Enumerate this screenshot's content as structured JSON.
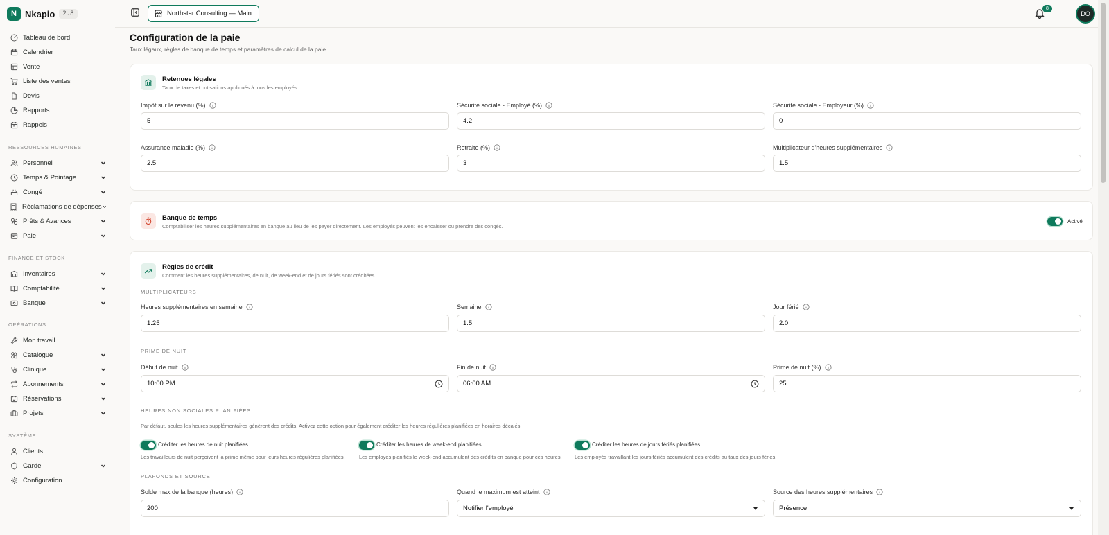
{
  "app": {
    "name": "Nkapio",
    "version": "2.8"
  },
  "topbar": {
    "org_name": "Northstar Consulting — Main",
    "notifications": "8",
    "avatar_initials": "DO"
  },
  "sidebar": {
    "main": [
      {
        "label": "Tableau de bord",
        "icon": "dashboard-icon"
      },
      {
        "label": "Calendrier",
        "icon": "calendar-icon"
      },
      {
        "label": "Vente",
        "icon": "pos-icon"
      },
      {
        "label": "Liste des ventes",
        "icon": "cart-icon"
      },
      {
        "label": "Devis",
        "icon": "document-icon"
      },
      {
        "label": "Rapports",
        "icon": "pie-chart-icon"
      },
      {
        "label": "Rappels",
        "icon": "reminder-icon"
      }
    ],
    "sections": [
      {
        "title": "Ressources humaines",
        "items": [
          {
            "label": "Personnel",
            "icon": "users-icon"
          },
          {
            "label": "Temps & Pointage",
            "icon": "clock-icon"
          },
          {
            "label": "Congé",
            "icon": "leave-icon"
          },
          {
            "label": "Réclamations de dépenses",
            "icon": "receipt-icon"
          },
          {
            "label": "Prêts & Avances",
            "icon": "loan-icon"
          },
          {
            "label": "Paie",
            "icon": "payroll-icon"
          }
        ]
      },
      {
        "title": "Finance et stock",
        "items": [
          {
            "label": "Inventaires",
            "icon": "inventory-icon"
          },
          {
            "label": "Comptabilité",
            "icon": "book-icon"
          },
          {
            "label": "Banque",
            "icon": "bank-icon"
          }
        ]
      },
      {
        "title": "Opérations",
        "items": [
          {
            "label": "Mon travail",
            "icon": "wrench-icon"
          },
          {
            "label": "Catalogue",
            "icon": "catalog-icon"
          },
          {
            "label": "Clinique",
            "icon": "stethoscope-icon"
          },
          {
            "label": "Abonnements",
            "icon": "repeat-icon"
          },
          {
            "label": "Réservations",
            "icon": "calendar-check-icon"
          },
          {
            "label": "Projets",
            "icon": "briefcase-icon"
          }
        ]
      },
      {
        "title": "Système",
        "items": [
          {
            "label": "Clients",
            "icon": "user-icon"
          },
          {
            "label": "Garde",
            "icon": "shield-icon"
          },
          {
            "label": "Configuration",
            "icon": "gear-icon"
          }
        ]
      }
    ]
  },
  "page": {
    "title": "Configuration de la paie",
    "subtitle": "Taux légaux, règles de banque de temps et paramètres de calcul de la paie."
  },
  "legal": {
    "title": "Retenues légales",
    "desc": "Taux de taxes et cotisations appliqués à tous les employés.",
    "fields": [
      {
        "label": "Impôt sur le revenu (%)",
        "value": "5"
      },
      {
        "label": "Sécurité sociale - Employé (%)",
        "value": "4.2"
      },
      {
        "label": "Sécurité sociale - Employeur (%)",
        "value": "0"
      },
      {
        "label": "Assurance maladie (%)",
        "value": "2.5"
      },
      {
        "label": "Retraite (%)",
        "value": "3"
      },
      {
        "label": "Multiplicateur d'heures supplémentaires",
        "value": "1.5"
      }
    ]
  },
  "timebank": {
    "title": "Banque de temps",
    "desc": "Comptabiliser les heures supplémentaires en banque au lieu de les payer directement. Les employés peuvent les encaisser ou prendre des congés.",
    "toggle_label": "Activé",
    "enabled": true
  },
  "credit": {
    "title": "Règles de crédit",
    "desc": "Comment les heures supplémentaires, de nuit, de week-end et de jours fériés sont créditées.",
    "multipliers_title": "Multiplicateurs",
    "multipliers": [
      {
        "label": "Heures supplémentaires en semaine",
        "value": "1.25"
      },
      {
        "label": "Semaine",
        "value": "1.5"
      },
      {
        "label": "Jour férié",
        "value": "2.0"
      }
    ],
    "night_title": "Prime de nuit",
    "night": [
      {
        "label": "Début de nuit",
        "value": "10:00 PM"
      },
      {
        "label": "Fin de nuit",
        "value": "06:00 AM"
      },
      {
        "label": "Prime de nuit (%)",
        "value": "25"
      }
    ],
    "unsocial_title": "Heures non sociales planifiées",
    "unsocial_desc": "Par défaut, seules les heures supplémentaires génèrent des crédits. Activez cette option pour également créditer les heures régulières planifiées en horaires décalés.",
    "toggles": [
      {
        "label": "Créditer les heures de nuit planifiées",
        "help": "Les travailleurs de nuit perçoivent la prime même pour leurs heures régulières planifiées.",
        "enabled": true
      },
      {
        "label": "Créditer les heures de week-end planifiées",
        "help": "Les employés planifiés le week-end accumulent des crédits en banque pour ces heures.",
        "enabled": true
      },
      {
        "label": "Créditer les heures de jours fériés planifiées",
        "help": "Les employés travaillant les jours fériés accumulent des crédits au taux des jours fériés.",
        "enabled": true
      }
    ],
    "caps_title": "Plafonds et source",
    "caps": [
      {
        "label": "Solde max de la banque (heures)",
        "value": "200"
      },
      {
        "label": "Quand le maximum est atteint",
        "value": "Notifier l'employé"
      },
      {
        "label": "Source des heures supplémentaires",
        "value": "Présence"
      }
    ]
  },
  "colors": {
    "accent": "#0f7a5c",
    "background": "#faf9f7",
    "danger_icon": "#d2462f"
  }
}
